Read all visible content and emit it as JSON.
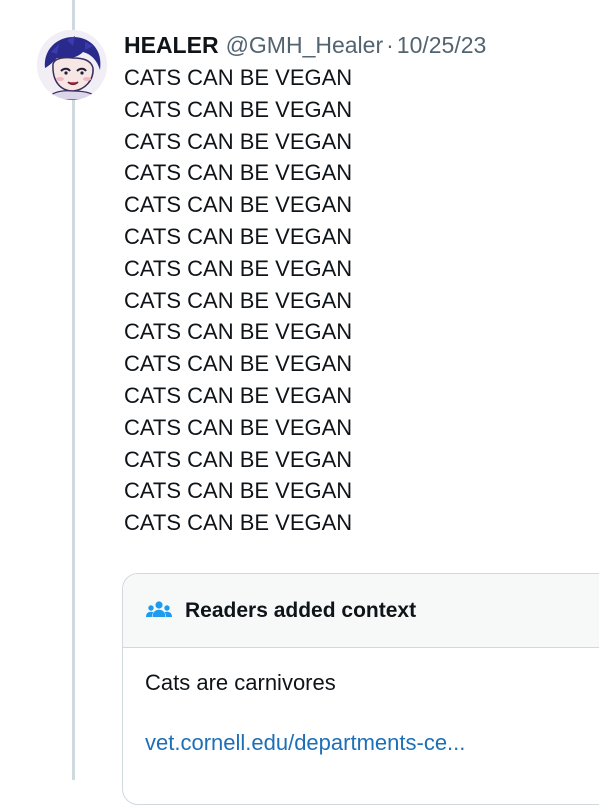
{
  "tweet": {
    "display_name": "HEALER",
    "handle": "@GMH_Healer",
    "separator": "·",
    "date": "10/25/23",
    "lines": [
      "CATS CAN BE VEGAN",
      "CATS CAN BE VEGAN",
      "CATS CAN BE VEGAN",
      "CATS CAN BE VEGAN",
      "CATS CAN BE VEGAN",
      "CATS CAN BE VEGAN",
      "CATS CAN BE VEGAN",
      "CATS CAN BE VEGAN",
      "CATS CAN BE VEGAN",
      "CATS CAN BE VEGAN",
      "CATS CAN BE VEGAN",
      "CATS CAN BE VEGAN",
      "CATS CAN BE VEGAN",
      "CATS CAN BE VEGAN",
      "CATS CAN BE VEGAN"
    ]
  },
  "community_note": {
    "title": "Readers added context",
    "icon": "people-icon",
    "text": "Cats are carnivores",
    "link_text": "vet.cornell.edu/departments-ce..."
  },
  "colors": {
    "text_primary": "#0f1419",
    "text_secondary": "#536471",
    "link": "#1d6fb8",
    "border": "#cfd9de",
    "note_header_bg": "#f7f9f9",
    "icon_blue": "#1d9bf0"
  }
}
